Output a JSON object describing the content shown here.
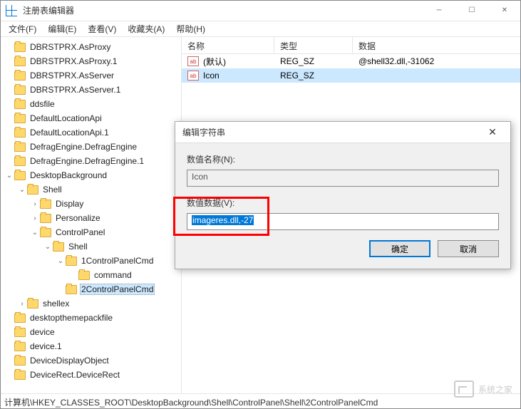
{
  "window": {
    "title": "注册表编辑器"
  },
  "menu": [
    {
      "label": "文件(F)"
    },
    {
      "label": "编辑(E)"
    },
    {
      "label": "查看(V)"
    },
    {
      "label": "收藏夹(A)"
    },
    {
      "label": "帮助(H)"
    }
  ],
  "tree": [
    {
      "indent": 0,
      "exp": "",
      "label": "DBRSTPRX.AsProxy"
    },
    {
      "indent": 0,
      "exp": "",
      "label": "DBRSTPRX.AsProxy.1"
    },
    {
      "indent": 0,
      "exp": "",
      "label": "DBRSTPRX.AsServer"
    },
    {
      "indent": 0,
      "exp": "",
      "label": "DBRSTPRX.AsServer.1"
    },
    {
      "indent": 0,
      "exp": "",
      "label": "ddsfile"
    },
    {
      "indent": 0,
      "exp": "",
      "label": "DefaultLocationApi"
    },
    {
      "indent": 0,
      "exp": "",
      "label": "DefaultLocationApi.1"
    },
    {
      "indent": 0,
      "exp": "",
      "label": "DefragEngine.DefragEngine"
    },
    {
      "indent": 0,
      "exp": "",
      "label": "DefragEngine.DefragEngine.1"
    },
    {
      "indent": 0,
      "exp": "v",
      "label": "DesktopBackground"
    },
    {
      "indent": 1,
      "exp": "v",
      "label": "Shell"
    },
    {
      "indent": 2,
      "exp": ">",
      "label": "Display"
    },
    {
      "indent": 2,
      "exp": ">",
      "label": "Personalize"
    },
    {
      "indent": 2,
      "exp": "v",
      "label": "ControlPanel"
    },
    {
      "indent": 3,
      "exp": "v",
      "label": "Shell"
    },
    {
      "indent": 4,
      "exp": "v",
      "label": "1ControlPanelCmd"
    },
    {
      "indent": 5,
      "exp": "",
      "label": "command"
    },
    {
      "indent": 4,
      "exp": "",
      "label": "2ControlPanelCmd",
      "selected": true
    },
    {
      "indent": 1,
      "exp": ">",
      "label": "shellex"
    },
    {
      "indent": 0,
      "exp": "",
      "label": "desktopthemepackfile"
    },
    {
      "indent": 0,
      "exp": "",
      "label": "device"
    },
    {
      "indent": 0,
      "exp": "",
      "label": "device.1"
    },
    {
      "indent": 0,
      "exp": "",
      "label": "DeviceDisplayObject"
    },
    {
      "indent": 0,
      "exp": "",
      "label": "DeviceRect.DeviceRect"
    }
  ],
  "list": {
    "headers": {
      "name": "名称",
      "type": "类型",
      "data": "数据"
    },
    "rows": [
      {
        "name": "(默认)",
        "type": "REG_SZ",
        "data": "@shell32.dll,-31062",
        "selected": false
      },
      {
        "name": "Icon",
        "type": "REG_SZ",
        "data": "",
        "selected": true
      }
    ]
  },
  "dialog": {
    "title": "编辑字符串",
    "name_label": "数值名称(N):",
    "name_value": "Icon",
    "data_label": "数值数据(V):",
    "data_value": "imageres.dll,-27",
    "ok": "确定",
    "cancel": "取消"
  },
  "statusbar": "计算机\\HKEY_CLASSES_ROOT\\DesktopBackground\\Shell\\ControlPanel\\Shell\\2ControlPanelCmd",
  "string_icon_text": "ab",
  "watermark": "系统之家"
}
